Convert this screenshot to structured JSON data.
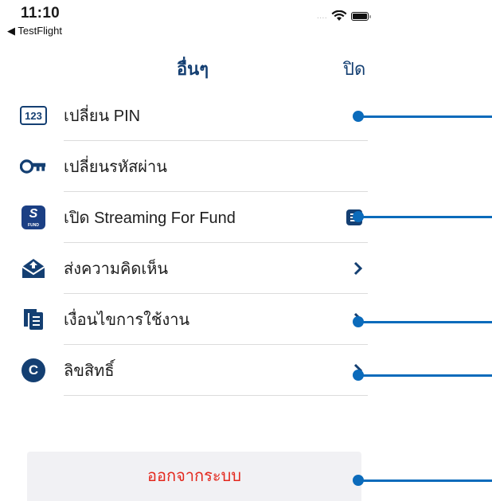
{
  "status_bar": {
    "time": "11:10",
    "back_app": "◀ TestFlight",
    "signal": "....",
    "wifi_icon": "wifi-icon",
    "battery_icon": "battery-icon"
  },
  "nav": {
    "title": "อื่นๆ",
    "close_label": "ปิด"
  },
  "menu": {
    "items": [
      {
        "label": "เปลี่ยน PIN",
        "icon": "pin-123-icon",
        "icon_text": "123"
      },
      {
        "label": "เปลี่ยนรหัสผ่าน",
        "icon": "key-icon"
      },
      {
        "label": "เปิด Streaming For Fund",
        "icon": "streaming-fund-app-icon",
        "icon_text": "S",
        "icon_subtext": "FUND"
      },
      {
        "label": "ส่งความคิดเห็น",
        "icon": "envelope-icon"
      },
      {
        "label": "เงื่อนไขการใช้งาน",
        "icon": "document-icon"
      },
      {
        "label": "ลิขสิทธิ์",
        "icon": "copyright-icon",
        "icon_text": "C"
      }
    ]
  },
  "logout": {
    "label": "ออกจากระบบ"
  },
  "colors": {
    "brand_navy": "#143f72",
    "logout_red": "#e3271c",
    "annotation_blue": "#0b6bbb",
    "separator": "#dcdcdc"
  }
}
